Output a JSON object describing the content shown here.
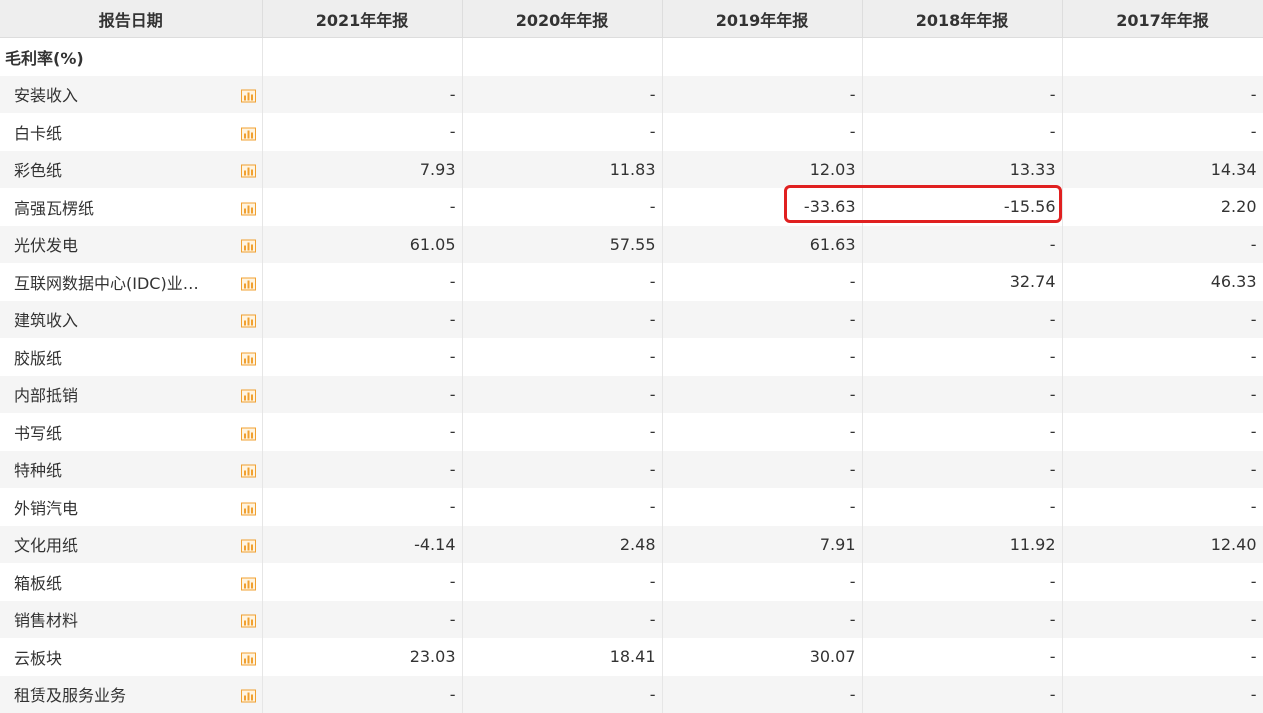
{
  "header": {
    "label": "报告日期",
    "years": [
      "2021年年报",
      "2020年年报",
      "2019年年报",
      "2018年年报",
      "2017年年报"
    ]
  },
  "section_title": "毛利率(%)",
  "rows": [
    {
      "name": "安装收入",
      "values": [
        "-",
        "-",
        "-",
        "-",
        "-"
      ]
    },
    {
      "name": "白卡纸",
      "values": [
        "-",
        "-",
        "-",
        "-",
        "-"
      ]
    },
    {
      "name": "彩色纸",
      "values": [
        "7.93",
        "11.83",
        "12.03",
        "13.33",
        "14.34"
      ]
    },
    {
      "name": "高强瓦楞纸",
      "values": [
        "-",
        "-",
        "-33.63",
        "-15.56",
        "2.20"
      ]
    },
    {
      "name": "光伏发电",
      "values": [
        "61.05",
        "57.55",
        "61.63",
        "-",
        "-"
      ]
    },
    {
      "name": "互联网数据中心(IDC)业…",
      "values": [
        "-",
        "-",
        "-",
        "32.74",
        "46.33"
      ]
    },
    {
      "name": "建筑收入",
      "values": [
        "-",
        "-",
        "-",
        "-",
        "-"
      ]
    },
    {
      "name": "胶版纸",
      "values": [
        "-",
        "-",
        "-",
        "-",
        "-"
      ]
    },
    {
      "name": "内部抵销",
      "values": [
        "-",
        "-",
        "-",
        "-",
        "-"
      ]
    },
    {
      "name": "书写纸",
      "values": [
        "-",
        "-",
        "-",
        "-",
        "-"
      ]
    },
    {
      "name": "特种纸",
      "values": [
        "-",
        "-",
        "-",
        "-",
        "-"
      ]
    },
    {
      "name": "外销汽电",
      "values": [
        "-",
        "-",
        "-",
        "-",
        "-"
      ]
    },
    {
      "name": "文化用纸",
      "values": [
        "-4.14",
        "2.48",
        "7.91",
        "11.92",
        "12.40"
      ]
    },
    {
      "name": "箱板纸",
      "values": [
        "-",
        "-",
        "-",
        "-",
        "-"
      ]
    },
    {
      "name": "销售材料",
      "values": [
        "-",
        "-",
        "-",
        "-",
        "-"
      ]
    },
    {
      "name": "云板块",
      "values": [
        "23.03",
        "18.41",
        "30.07",
        "-",
        "-"
      ]
    },
    {
      "name": "租赁及服务业务",
      "values": [
        "-",
        "-",
        "-",
        "-",
        "-"
      ]
    }
  ],
  "icons": {
    "row_chart": "bar-chart-icon"
  },
  "colors": {
    "highlight": "#e02020",
    "icon": "#f0a030",
    "header_bg": "#eeeeee",
    "stripe": "#f5f5f5"
  }
}
